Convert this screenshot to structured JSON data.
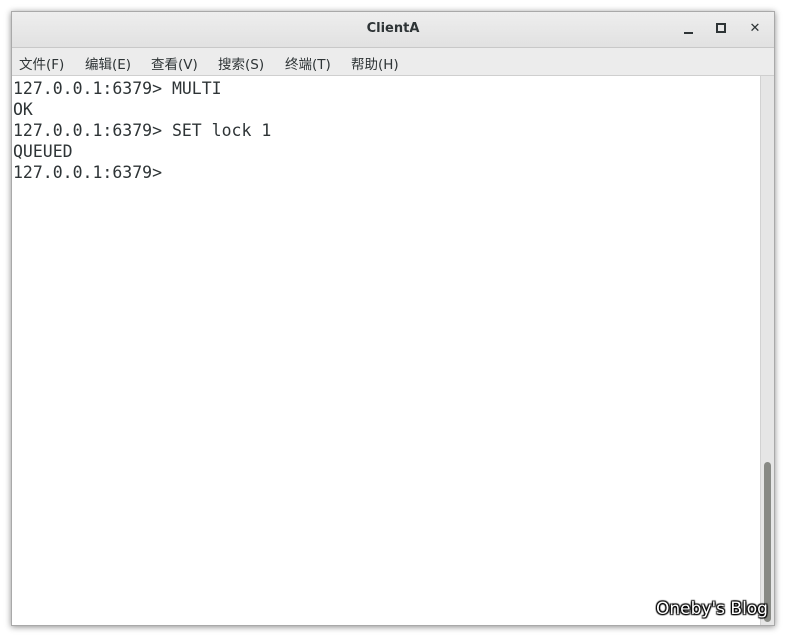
{
  "window": {
    "title": "ClientA",
    "controls": {
      "minimize": "minimize-icon",
      "maximize": "maximize-icon",
      "close": "close-icon"
    }
  },
  "menu": {
    "items": [
      {
        "label": "文件(F)"
      },
      {
        "label": "编辑(E)"
      },
      {
        "label": "查看(V)"
      },
      {
        "label": "搜索(S)"
      },
      {
        "label": "终端(T)"
      },
      {
        "label": "帮助(H)"
      }
    ]
  },
  "terminal": {
    "lines": [
      "127.0.0.1:6379> MULTI",
      "OK",
      "127.0.0.1:6379> SET lock 1",
      "QUEUED",
      "127.0.0.1:6379>"
    ]
  },
  "watermark": "Oneby's Blog",
  "colors": {
    "text": "#2e3436",
    "background": "#ffffff",
    "titlebar": "#e8e8e8"
  }
}
